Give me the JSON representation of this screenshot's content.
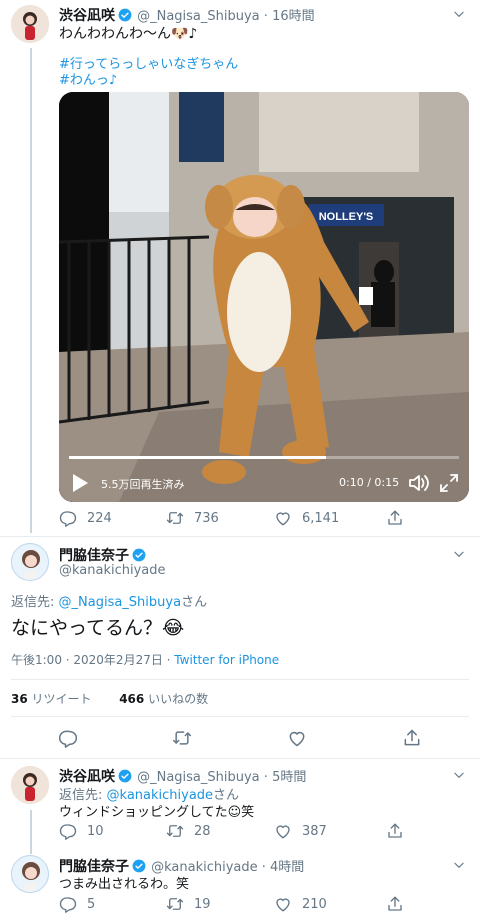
{
  "tweet1": {
    "name": "渋谷凪咲",
    "handle": "@_Nagisa_Shibuya",
    "time": "16時間",
    "text": "わんわわんわ〜ん🐶♪",
    "hashtag1": "#行ってらっしゃいなぎちゃん",
    "hashtag2": "#わんっ♪",
    "video": {
      "views": "5.5万回再生済み",
      "time": "0:10 / 0:15",
      "progress": 0.66,
      "sign": "NOLLEY'S"
    },
    "reply_count": "224",
    "retweet_count": "736",
    "like_count": "6,141"
  },
  "tweet2": {
    "name": "門脇佳奈子",
    "handle": "@kanakichiyade",
    "reply_prefix": "返信先: ",
    "reply_to": "@_Nagisa_Shibuya",
    "reply_suffix": "さん",
    "text": "なにやってるん？😂",
    "timestamp": "午後1:00 · 2020年2月27日 · ",
    "client": "Twitter for iPhone",
    "retweets_num": "36",
    "retweets_label": " リツイート",
    "likes_num": "466",
    "likes_label": " いいねの数"
  },
  "tweet3": {
    "name": "渋谷凪咲",
    "handle": "@_Nagisa_Shibuya",
    "time": "5時間",
    "reply_prefix": "返信先: ",
    "reply_to": "@kanakichiyade",
    "reply_suffix": "さん",
    "text": "ウィンドショッピングしてた☺笑",
    "reply_count": "10",
    "retweet_count": "28",
    "like_count": "387"
  },
  "tweet4": {
    "name": "門脇佳奈子",
    "handle": "@kanakichiyade",
    "time": "4時間",
    "text": "つまみ出されるわ。笑",
    "reply_count": "5",
    "retweet_count": "19",
    "like_count": "210"
  },
  "separator": " · ",
  "colors": {
    "link": "#1b95e0",
    "verified": "#1da1f2",
    "muted": "#657786"
  },
  "icons": [
    "reply-icon",
    "retweet-icon",
    "like-icon",
    "share-icon",
    "verified-badge-icon",
    "chevron-down-icon",
    "play-icon",
    "volume-icon",
    "fullscreen-icon"
  ]
}
